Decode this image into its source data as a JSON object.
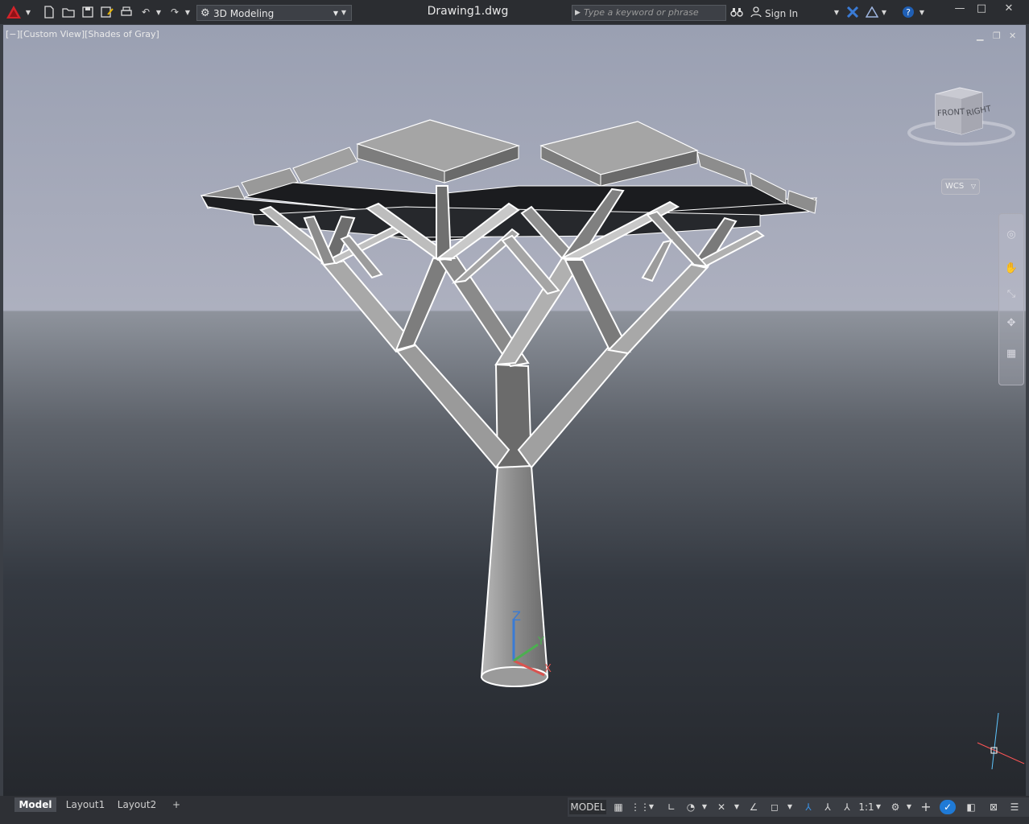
{
  "app": {
    "file_title": "Drawing1.dwg",
    "workspace": "3D Modeling",
    "search_placeholder": "Type a keyword or phrase",
    "signin_label": "Sign In"
  },
  "viewport": {
    "label": "[−][Custom View][Shades of Gray]",
    "viewcube_front": "FRONT",
    "viewcube_right": "RIGHT",
    "wcs_label": "WCS",
    "ucs_axes": [
      "Z",
      "Y",
      "X"
    ]
  },
  "tabs": {
    "model": "Model",
    "layout1": "Layout1",
    "layout2": "Layout2",
    "add": "+"
  },
  "status": {
    "model_label": "MODEL",
    "scale": "1:1"
  },
  "icons": {
    "app_menu": "autocad-logo-icon",
    "new": "new-file-icon",
    "open": "open-folder-icon",
    "save": "save-icon",
    "save_as": "save-as-icon",
    "plot": "print-icon",
    "undo": "undo-icon",
    "redo": "redo-icon",
    "help": "help-icon"
  },
  "colors": {
    "accent": "#1f7ad6",
    "autocad_red": "#d2232a",
    "ucs_x": "#d9534f",
    "ucs_y": "#4caf50",
    "ucs_z": "#3a7bd5"
  }
}
